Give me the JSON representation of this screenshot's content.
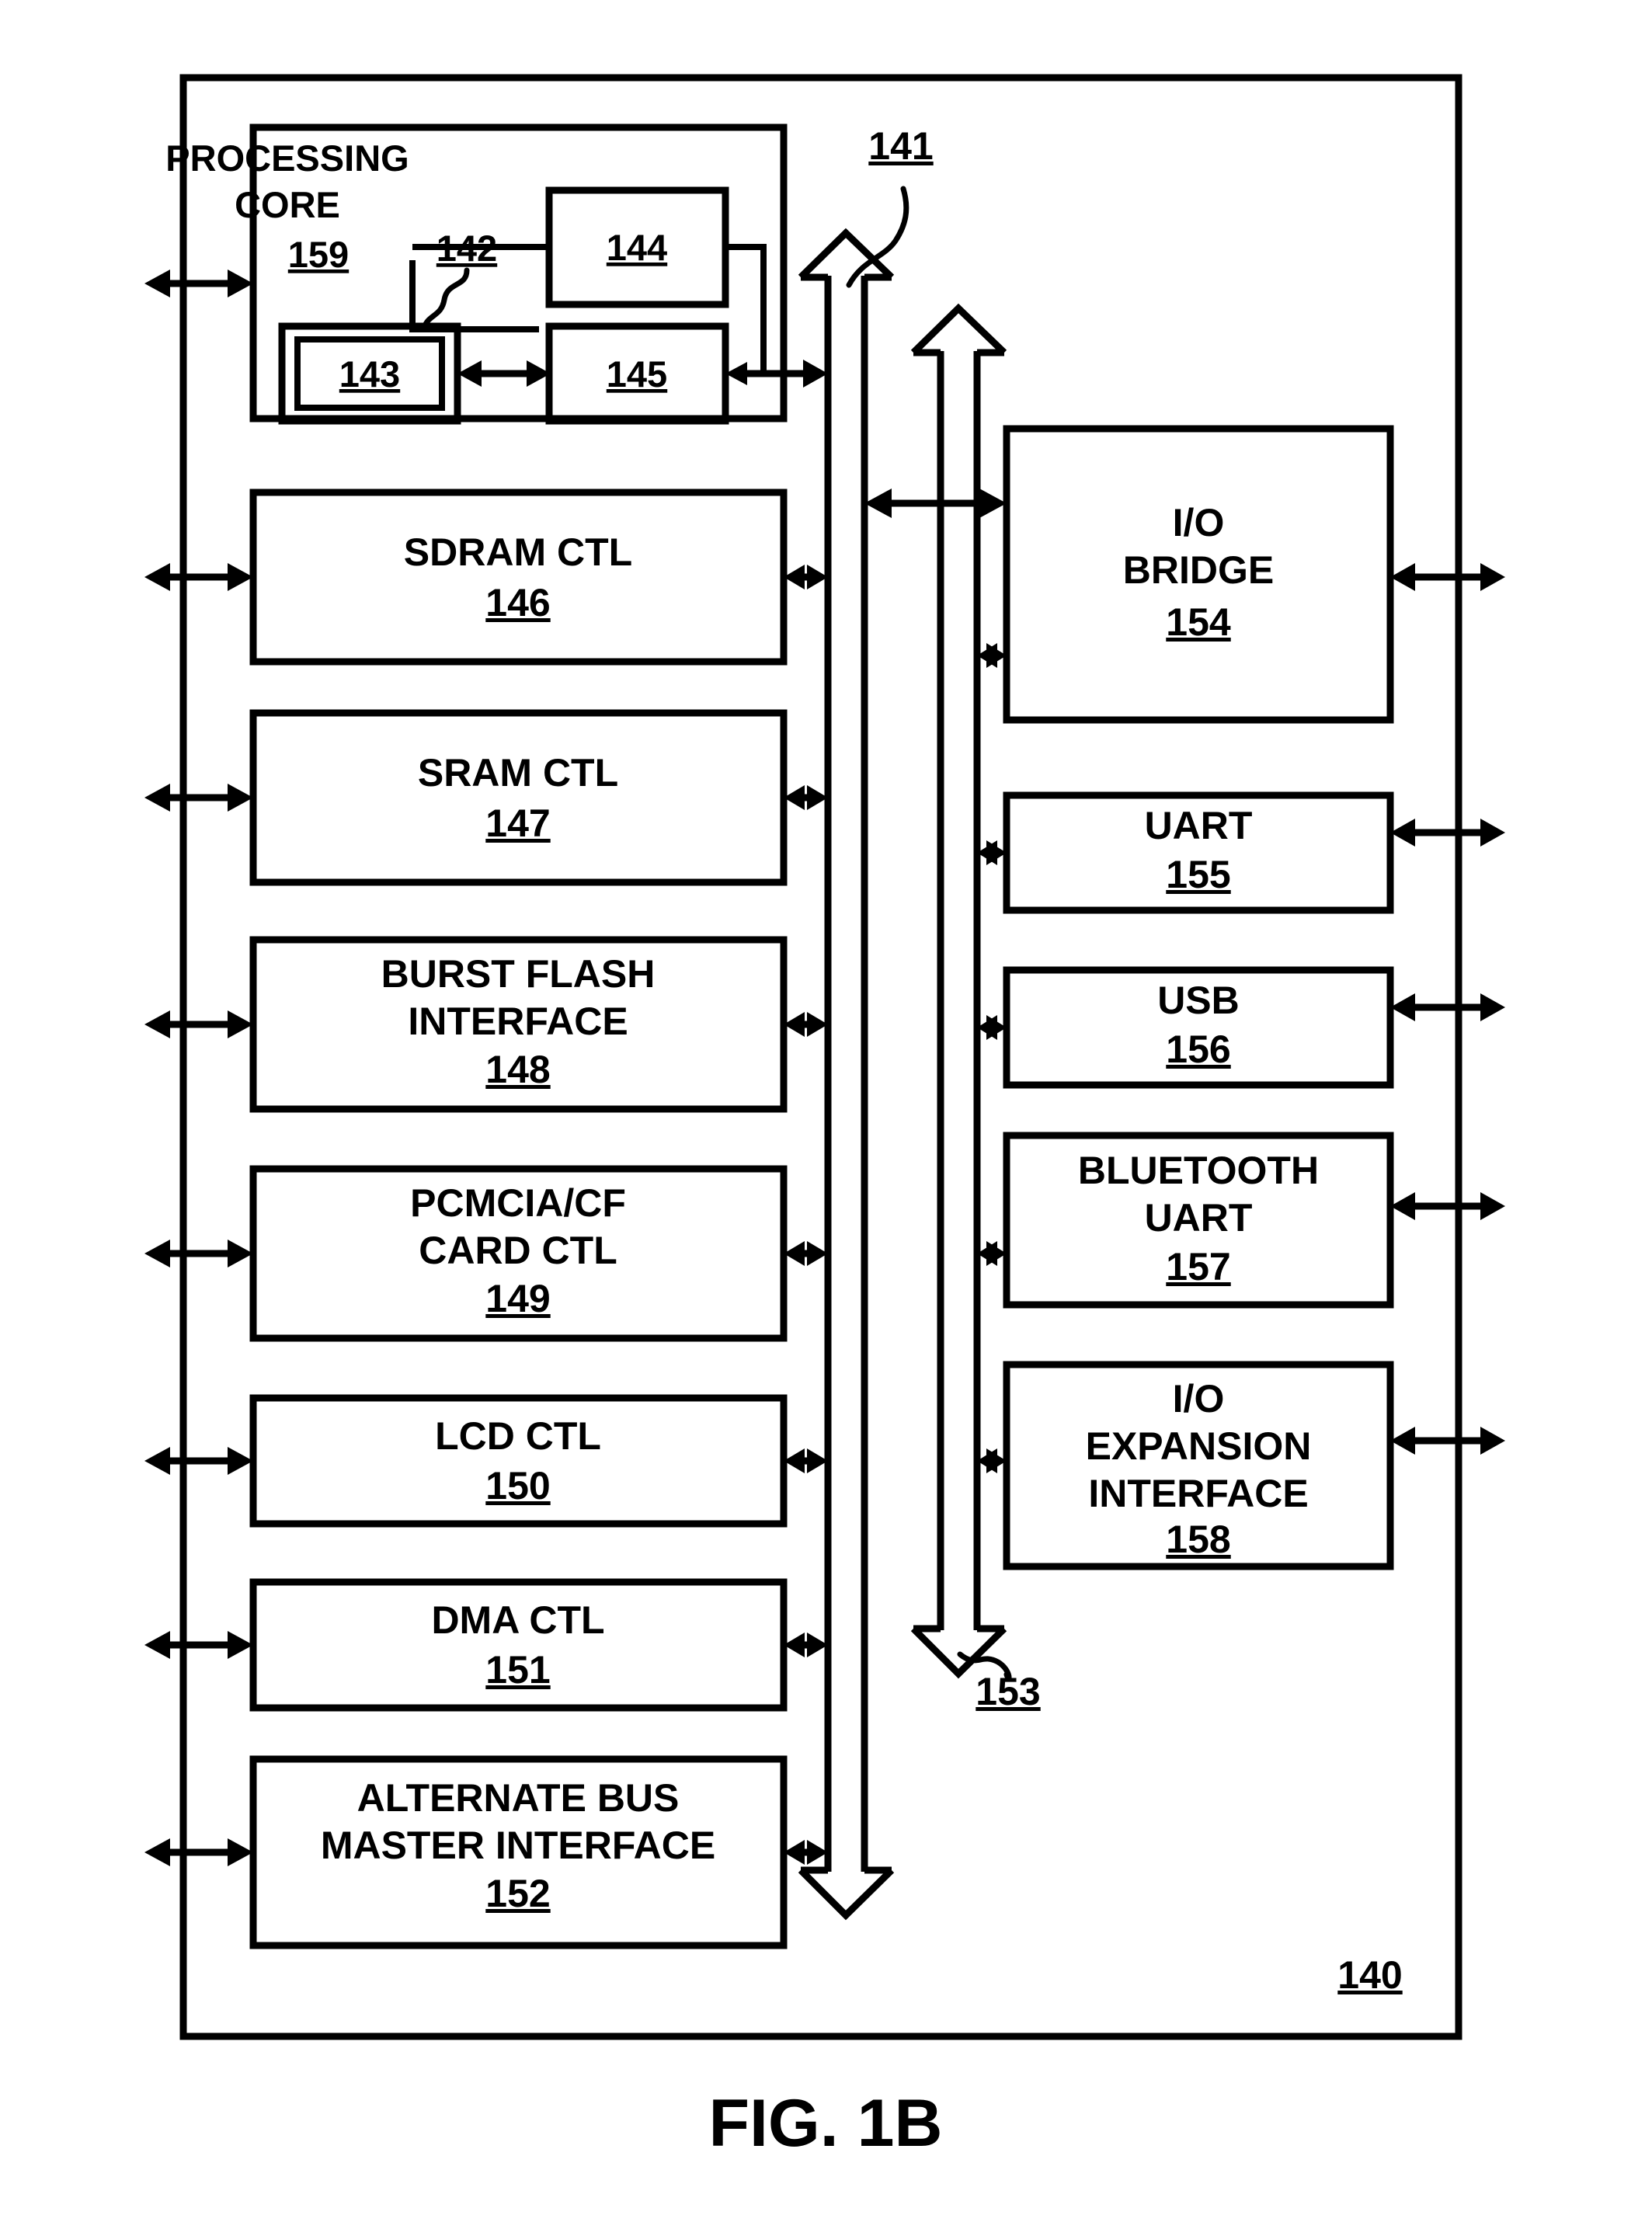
{
  "figure": {
    "caption": "FIG. 1B",
    "chip_ref": "140",
    "main_bus_ref": "141",
    "secondary_bus_ref": "153"
  },
  "processing_core": {
    "title_line1": "PROCESSING",
    "title_line2": "CORE",
    "ref": "159",
    "inner_ref": "142",
    "blocks": [
      {
        "ref": "143"
      },
      {
        "ref": "144"
      },
      {
        "ref": "145"
      }
    ]
  },
  "left_column": [
    {
      "lines": [
        "SDRAM CTL"
      ],
      "ref": "146"
    },
    {
      "lines": [
        "SRAM CTL"
      ],
      "ref": "147"
    },
    {
      "lines": [
        "BURST FLASH",
        "INTERFACE"
      ],
      "ref": "148"
    },
    {
      "lines": [
        "PCMCIA/CF",
        "CARD CTL"
      ],
      "ref": "149"
    },
    {
      "lines": [
        "LCD CTL"
      ],
      "ref": "150"
    },
    {
      "lines": [
        "DMA CTL"
      ],
      "ref": "151"
    },
    {
      "lines": [
        "ALTERNATE BUS",
        "MASTER INTERFACE"
      ],
      "ref": "152"
    }
  ],
  "right_column": [
    {
      "lines": [
        "I/O",
        "BRIDGE"
      ],
      "ref": "154"
    },
    {
      "lines": [
        "UART"
      ],
      "ref": "155"
    },
    {
      "lines": [
        "USB"
      ],
      "ref": "156"
    },
    {
      "lines": [
        "BLUETOOTH",
        "UART"
      ],
      "ref": "157"
    },
    {
      "lines": [
        "I/O",
        "EXPANSION",
        "INTERFACE"
      ],
      "ref": "158"
    }
  ],
  "colors": {
    "ink": "#000000",
    "paper": "#ffffff"
  }
}
